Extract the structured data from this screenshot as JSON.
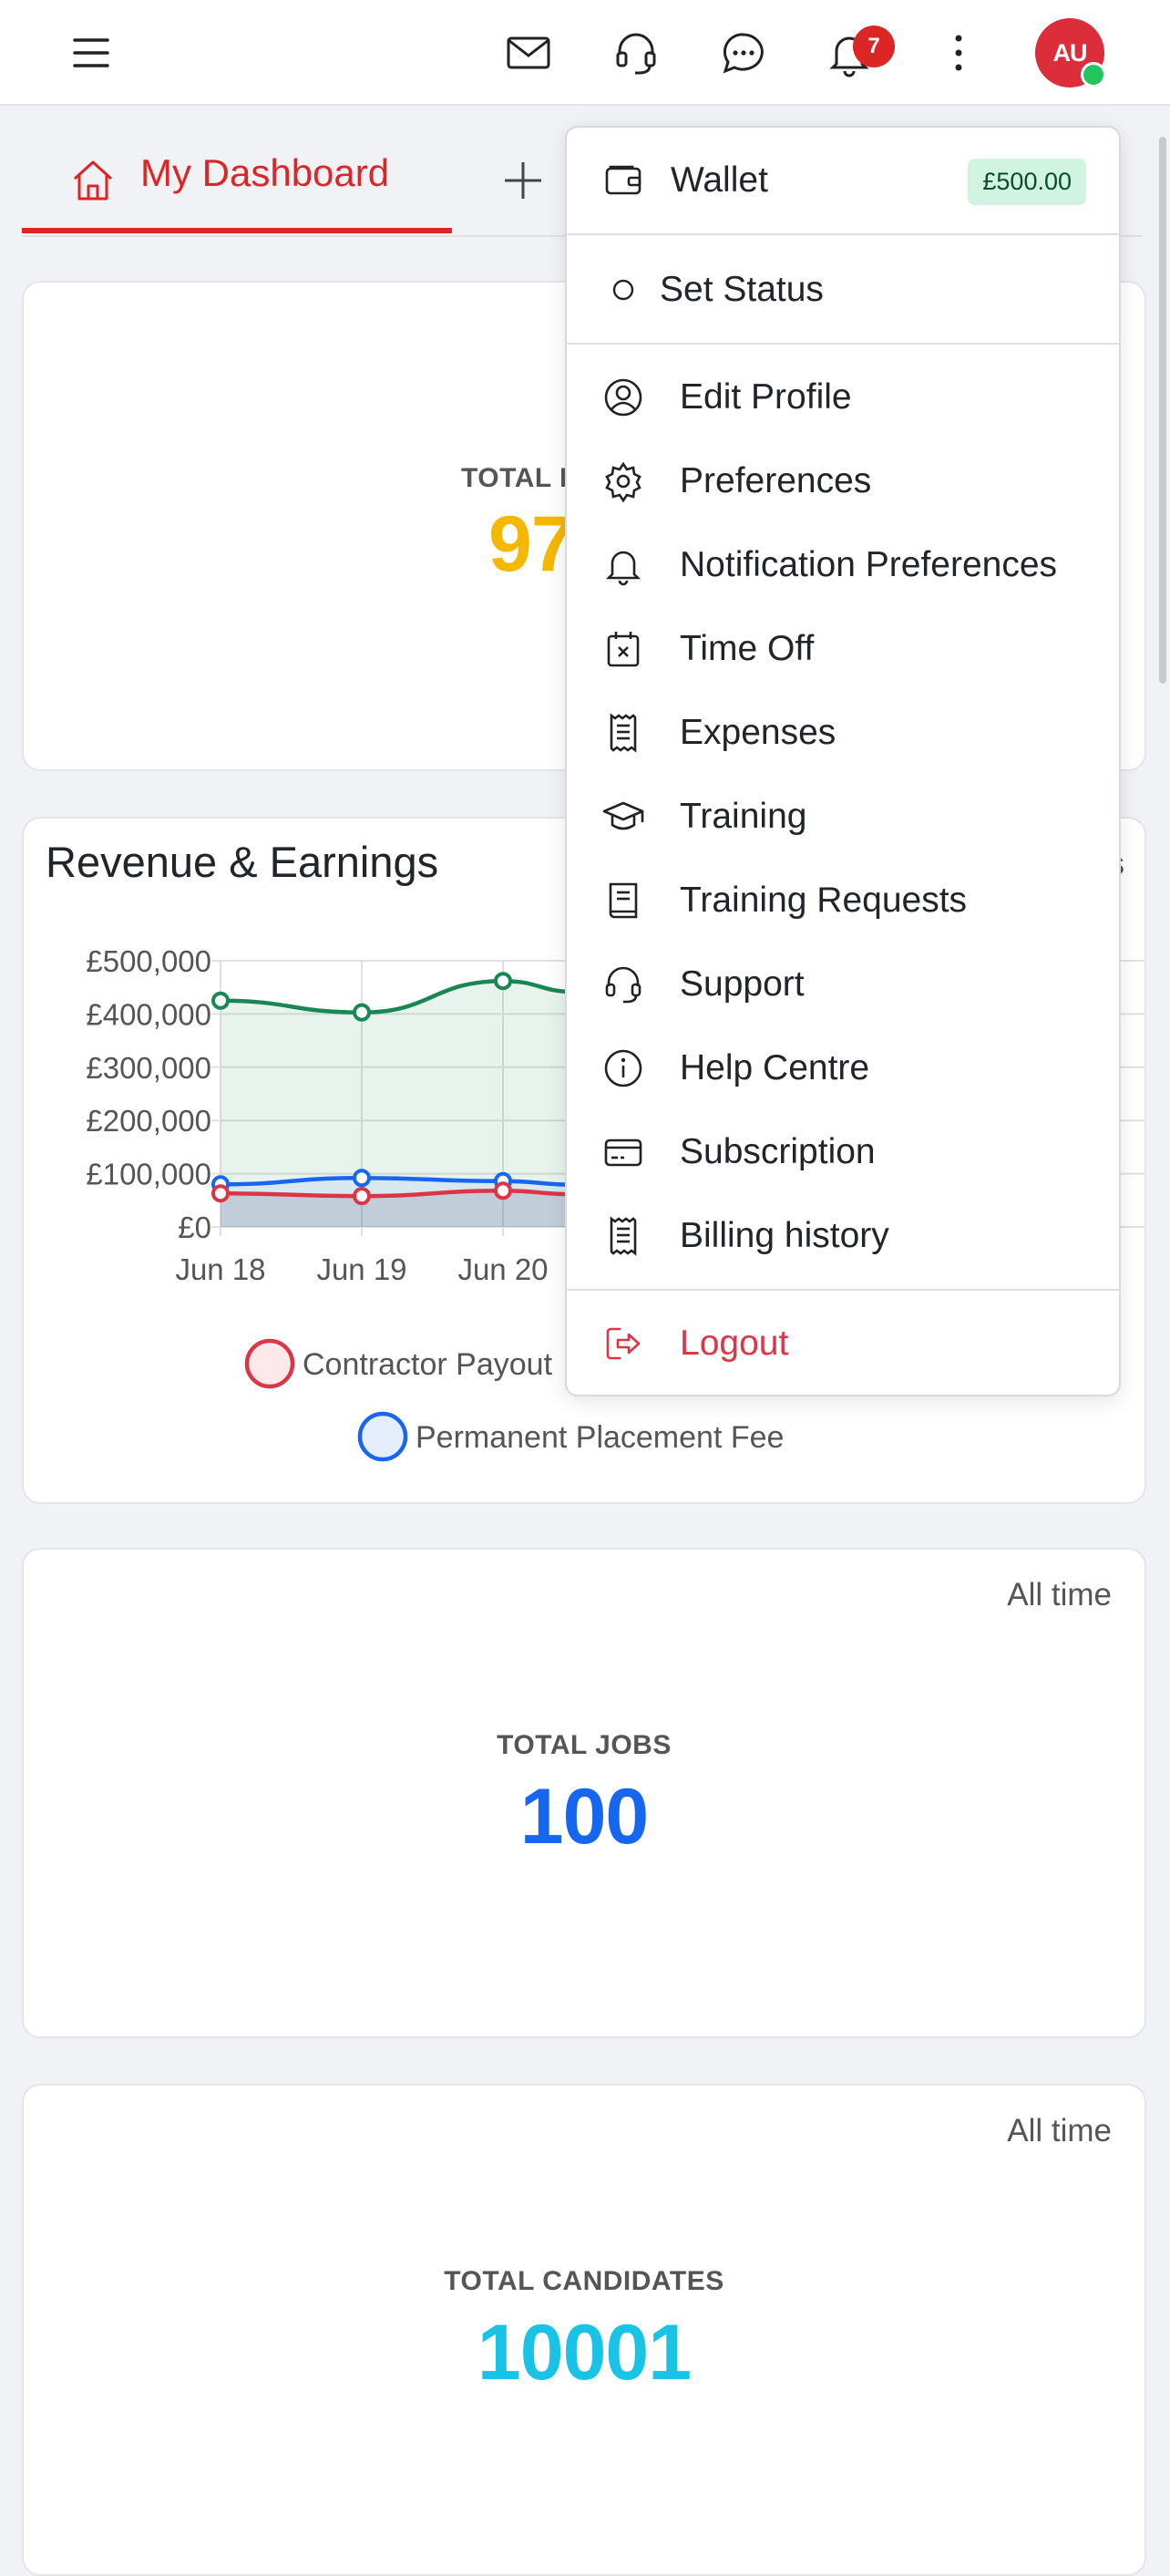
{
  "topbar": {
    "icons": [
      "menu-icon",
      "mail-icon",
      "headset-icon",
      "chat-icon",
      "bell-icon",
      "more-vertical-icon"
    ],
    "notification_count": "7",
    "avatar_initials": "AU",
    "presence_color": "#22c55e"
  },
  "tabs": {
    "active_label": "My Dashboard",
    "add_icon": "plus-icon"
  },
  "cards": {
    "earnings": {
      "label": "TOTAL E",
      "value": "97",
      "color": "#f5b800"
    },
    "jobs": {
      "meta": "All time",
      "label": "TOTAL JOBS",
      "value": "100",
      "color": "#1766f0"
    },
    "candidates": {
      "meta": "All time",
      "label": "TOTAL CANDIDATES",
      "value": "10001",
      "color": "#18c3e6"
    }
  },
  "chart": {
    "title": "Revenue & Earnings",
    "partial_meta": "s",
    "legend": [
      {
        "name": "Contractor Payout",
        "color": "#dc3545"
      },
      {
        "name": "Permanent Placement Fee",
        "color": "#1766f0"
      }
    ]
  },
  "chart_data": {
    "type": "line",
    "title": "Revenue & Earnings",
    "categories": [
      "Jun 18",
      "Jun 19",
      "Jun 20"
    ],
    "yticks": [
      "£500,000",
      "£400,000",
      "£300,000",
      "£200,000",
      "£100,000",
      "£0"
    ],
    "ylim": [
      0,
      500000
    ],
    "series": [
      {
        "values": [
          425000,
          403000,
          462000
        ],
        "color": "#198754"
      },
      {
        "name": "Permanent Placement Fee",
        "values": [
          80000,
          92000,
          86000
        ],
        "color": "#1766f0"
      },
      {
        "name": "Contractor Payout",
        "values": [
          63000,
          58000,
          68000
        ],
        "color": "#dc3545"
      }
    ],
    "grid": true
  },
  "menu": {
    "wallet": {
      "label": "Wallet",
      "amount": "£500.00"
    },
    "status_label": "Set Status",
    "items": [
      {
        "label": "Edit Profile",
        "icon": "user-circle-icon"
      },
      {
        "label": "Preferences",
        "icon": "gear-icon"
      },
      {
        "label": "Notification Preferences",
        "icon": "bell-icon"
      },
      {
        "label": "Time Off",
        "icon": "calendar-x-icon"
      },
      {
        "label": "Expenses",
        "icon": "receipt-icon"
      },
      {
        "label": "Training",
        "icon": "graduation-cap-icon"
      },
      {
        "label": "Training Requests",
        "icon": "book-icon"
      },
      {
        "label": "Support",
        "icon": "headset-icon"
      },
      {
        "label": "Help Centre",
        "icon": "info-icon"
      },
      {
        "label": "Subscription",
        "icon": "credit-card-icon"
      },
      {
        "label": "Billing history",
        "icon": "receipt-icon"
      }
    ],
    "logout_label": "Logout",
    "logout_color": "#dc3545"
  }
}
